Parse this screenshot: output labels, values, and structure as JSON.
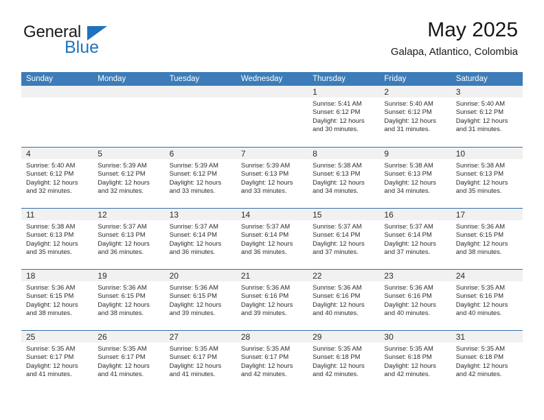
{
  "brand": {
    "line1": "General",
    "line2": "Blue",
    "triangle_color": "#1f72bd",
    "icon": "triangle-icon"
  },
  "header": {
    "title": "May 2025",
    "subtitle": "Galapa, Atlantico, Colombia"
  },
  "theme": {
    "header_row_bg": "#3c7cb8",
    "week_divider": "#2f6da8",
    "day_band_bg": "#f1f1f1",
    "text": "#2b2b2b"
  },
  "calendar": {
    "day_headers": [
      "Sunday",
      "Monday",
      "Tuesday",
      "Wednesday",
      "Thursday",
      "Friday",
      "Saturday"
    ],
    "weeks": [
      [
        {
          "day": "",
          "empty": true
        },
        {
          "day": "",
          "empty": true
        },
        {
          "day": "",
          "empty": true
        },
        {
          "day": "",
          "empty": true
        },
        {
          "day": "1",
          "sunrise": "Sunrise: 5:41 AM",
          "sunset": "Sunset: 6:12 PM",
          "daylight_1": "Daylight: 12 hours",
          "daylight_2": "and 30 minutes."
        },
        {
          "day": "2",
          "sunrise": "Sunrise: 5:40 AM",
          "sunset": "Sunset: 6:12 PM",
          "daylight_1": "Daylight: 12 hours",
          "daylight_2": "and 31 minutes."
        },
        {
          "day": "3",
          "sunrise": "Sunrise: 5:40 AM",
          "sunset": "Sunset: 6:12 PM",
          "daylight_1": "Daylight: 12 hours",
          "daylight_2": "and 31 minutes."
        }
      ],
      [
        {
          "day": "4",
          "sunrise": "Sunrise: 5:40 AM",
          "sunset": "Sunset: 6:12 PM",
          "daylight_1": "Daylight: 12 hours",
          "daylight_2": "and 32 minutes."
        },
        {
          "day": "5",
          "sunrise": "Sunrise: 5:39 AM",
          "sunset": "Sunset: 6:12 PM",
          "daylight_1": "Daylight: 12 hours",
          "daylight_2": "and 32 minutes."
        },
        {
          "day": "6",
          "sunrise": "Sunrise: 5:39 AM",
          "sunset": "Sunset: 6:12 PM",
          "daylight_1": "Daylight: 12 hours",
          "daylight_2": "and 33 minutes."
        },
        {
          "day": "7",
          "sunrise": "Sunrise: 5:39 AM",
          "sunset": "Sunset: 6:13 PM",
          "daylight_1": "Daylight: 12 hours",
          "daylight_2": "and 33 minutes."
        },
        {
          "day": "8",
          "sunrise": "Sunrise: 5:38 AM",
          "sunset": "Sunset: 6:13 PM",
          "daylight_1": "Daylight: 12 hours",
          "daylight_2": "and 34 minutes."
        },
        {
          "day": "9",
          "sunrise": "Sunrise: 5:38 AM",
          "sunset": "Sunset: 6:13 PM",
          "daylight_1": "Daylight: 12 hours",
          "daylight_2": "and 34 minutes."
        },
        {
          "day": "10",
          "sunrise": "Sunrise: 5:38 AM",
          "sunset": "Sunset: 6:13 PM",
          "daylight_1": "Daylight: 12 hours",
          "daylight_2": "and 35 minutes."
        }
      ],
      [
        {
          "day": "11",
          "sunrise": "Sunrise: 5:38 AM",
          "sunset": "Sunset: 6:13 PM",
          "daylight_1": "Daylight: 12 hours",
          "daylight_2": "and 35 minutes."
        },
        {
          "day": "12",
          "sunrise": "Sunrise: 5:37 AM",
          "sunset": "Sunset: 6:13 PM",
          "daylight_1": "Daylight: 12 hours",
          "daylight_2": "and 36 minutes."
        },
        {
          "day": "13",
          "sunrise": "Sunrise: 5:37 AM",
          "sunset": "Sunset: 6:14 PM",
          "daylight_1": "Daylight: 12 hours",
          "daylight_2": "and 36 minutes."
        },
        {
          "day": "14",
          "sunrise": "Sunrise: 5:37 AM",
          "sunset": "Sunset: 6:14 PM",
          "daylight_1": "Daylight: 12 hours",
          "daylight_2": "and 36 minutes."
        },
        {
          "day": "15",
          "sunrise": "Sunrise: 5:37 AM",
          "sunset": "Sunset: 6:14 PM",
          "daylight_1": "Daylight: 12 hours",
          "daylight_2": "and 37 minutes."
        },
        {
          "day": "16",
          "sunrise": "Sunrise: 5:37 AM",
          "sunset": "Sunset: 6:14 PM",
          "daylight_1": "Daylight: 12 hours",
          "daylight_2": "and 37 minutes."
        },
        {
          "day": "17",
          "sunrise": "Sunrise: 5:36 AM",
          "sunset": "Sunset: 6:15 PM",
          "daylight_1": "Daylight: 12 hours",
          "daylight_2": "and 38 minutes."
        }
      ],
      [
        {
          "day": "18",
          "sunrise": "Sunrise: 5:36 AM",
          "sunset": "Sunset: 6:15 PM",
          "daylight_1": "Daylight: 12 hours",
          "daylight_2": "and 38 minutes."
        },
        {
          "day": "19",
          "sunrise": "Sunrise: 5:36 AM",
          "sunset": "Sunset: 6:15 PM",
          "daylight_1": "Daylight: 12 hours",
          "daylight_2": "and 38 minutes."
        },
        {
          "day": "20",
          "sunrise": "Sunrise: 5:36 AM",
          "sunset": "Sunset: 6:15 PM",
          "daylight_1": "Daylight: 12 hours",
          "daylight_2": "and 39 minutes."
        },
        {
          "day": "21",
          "sunrise": "Sunrise: 5:36 AM",
          "sunset": "Sunset: 6:16 PM",
          "daylight_1": "Daylight: 12 hours",
          "daylight_2": "and 39 minutes."
        },
        {
          "day": "22",
          "sunrise": "Sunrise: 5:36 AM",
          "sunset": "Sunset: 6:16 PM",
          "daylight_1": "Daylight: 12 hours",
          "daylight_2": "and 40 minutes."
        },
        {
          "day": "23",
          "sunrise": "Sunrise: 5:36 AM",
          "sunset": "Sunset: 6:16 PM",
          "daylight_1": "Daylight: 12 hours",
          "daylight_2": "and 40 minutes."
        },
        {
          "day": "24",
          "sunrise": "Sunrise: 5:35 AM",
          "sunset": "Sunset: 6:16 PM",
          "daylight_1": "Daylight: 12 hours",
          "daylight_2": "and 40 minutes."
        }
      ],
      [
        {
          "day": "25",
          "sunrise": "Sunrise: 5:35 AM",
          "sunset": "Sunset: 6:17 PM",
          "daylight_1": "Daylight: 12 hours",
          "daylight_2": "and 41 minutes."
        },
        {
          "day": "26",
          "sunrise": "Sunrise: 5:35 AM",
          "sunset": "Sunset: 6:17 PM",
          "daylight_1": "Daylight: 12 hours",
          "daylight_2": "and 41 minutes."
        },
        {
          "day": "27",
          "sunrise": "Sunrise: 5:35 AM",
          "sunset": "Sunset: 6:17 PM",
          "daylight_1": "Daylight: 12 hours",
          "daylight_2": "and 41 minutes."
        },
        {
          "day": "28",
          "sunrise": "Sunrise: 5:35 AM",
          "sunset": "Sunset: 6:17 PM",
          "daylight_1": "Daylight: 12 hours",
          "daylight_2": "and 42 minutes."
        },
        {
          "day": "29",
          "sunrise": "Sunrise: 5:35 AM",
          "sunset": "Sunset: 6:18 PM",
          "daylight_1": "Daylight: 12 hours",
          "daylight_2": "and 42 minutes."
        },
        {
          "day": "30",
          "sunrise": "Sunrise: 5:35 AM",
          "sunset": "Sunset: 6:18 PM",
          "daylight_1": "Daylight: 12 hours",
          "daylight_2": "and 42 minutes."
        },
        {
          "day": "31",
          "sunrise": "Sunrise: 5:35 AM",
          "sunset": "Sunset: 6:18 PM",
          "daylight_1": "Daylight: 12 hours",
          "daylight_2": "and 42 minutes."
        }
      ]
    ]
  }
}
